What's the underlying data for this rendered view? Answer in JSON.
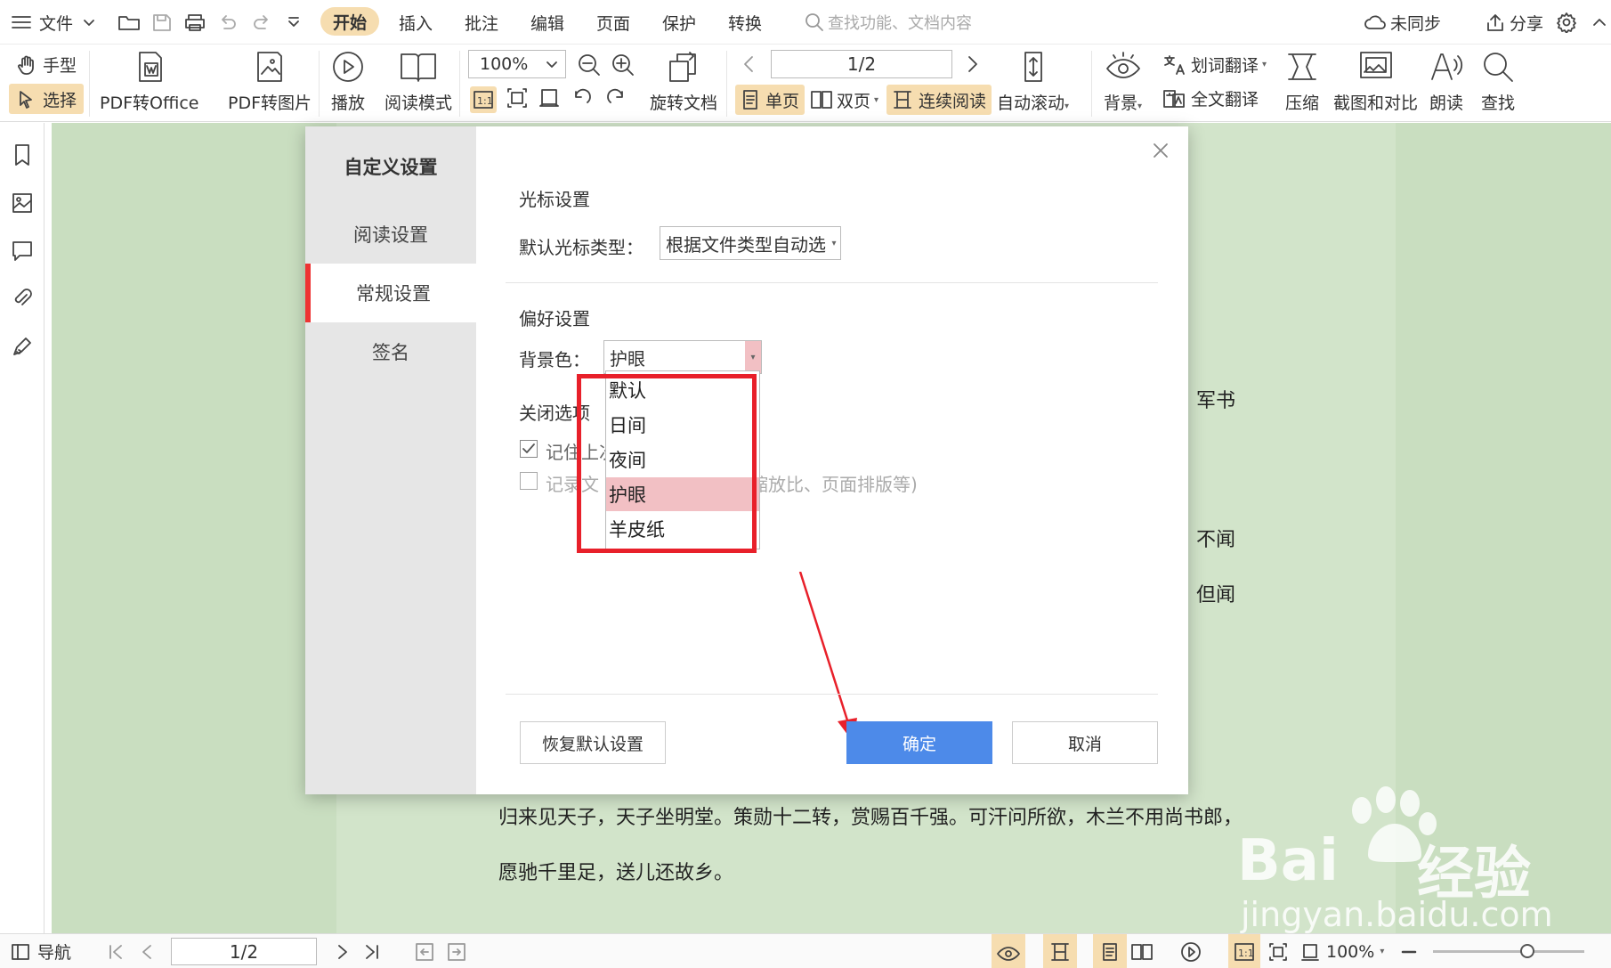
{
  "menubar": {
    "file": "文件",
    "tabs": [
      "开始",
      "插入",
      "批注",
      "编辑",
      "页面",
      "保护",
      "转换"
    ],
    "search_placeholder": "查找功能、文档内容",
    "sync": "未同步",
    "share": "分享"
  },
  "toolbar": {
    "hand": "手型",
    "select": "选择",
    "pdf_to_office": "PDF转Office",
    "pdf_to_image": "PDF转图片",
    "play": "播放",
    "read_mode": "阅读模式",
    "zoom": "100%",
    "rotate": "旋转文档",
    "page_indicator": "1/2",
    "single": "单页",
    "double": "双页",
    "continuous": "连续阅读",
    "auto_scroll": "自动滚动",
    "background": "背景",
    "word_translate": "划词翻译",
    "full_translate": "全文翻译",
    "compress": "压缩",
    "screenshot_compare": "截图和对比",
    "read_aloud": "朗读",
    "find": "查找"
  },
  "document": {
    "frag1": "军书",
    "frag2": "不闻",
    "frag3": "但闻",
    "line1": "归来见天子，天子坐明堂。策勋十二转，赏赐百千强。可汗问所欲，木兰不用尚书郎，",
    "line2": "愿驰千里足，送儿还故乡。"
  },
  "dialog": {
    "title": "自定义设置",
    "nav": [
      "阅读设置",
      "常规设置",
      "签名"
    ],
    "cursor_section": "光标设置",
    "cursor_label": "默认光标类型：",
    "cursor_value": "根据文件类型自动选",
    "pref_section": "偏好设置",
    "bg_label": "背景色：",
    "bg_value": "护眼",
    "bg_options": [
      "默认",
      "日间",
      "夜间",
      "护眼",
      "羊皮纸"
    ],
    "close_section": "关闭选项",
    "remember": "记住上次",
    "record_prefix": "记录文",
    "record_suffix": "缩放比、页面排版等)",
    "reset": "恢复默认设置",
    "ok": "确定",
    "cancel": "取消"
  },
  "statusbar": {
    "nav": "导航",
    "page": "1/2",
    "zoom": "100%"
  },
  "watermark": {
    "brand": "Bai",
    "brand2": "经验",
    "url": "jingyan.baidu.com"
  },
  "colors": {
    "accent": "#4d8ae9",
    "highlight": "#f6ddb0",
    "eye_care_bg": "#c9dec0",
    "annotation_red": "#e8202a",
    "nav_active": "#ee3333"
  }
}
